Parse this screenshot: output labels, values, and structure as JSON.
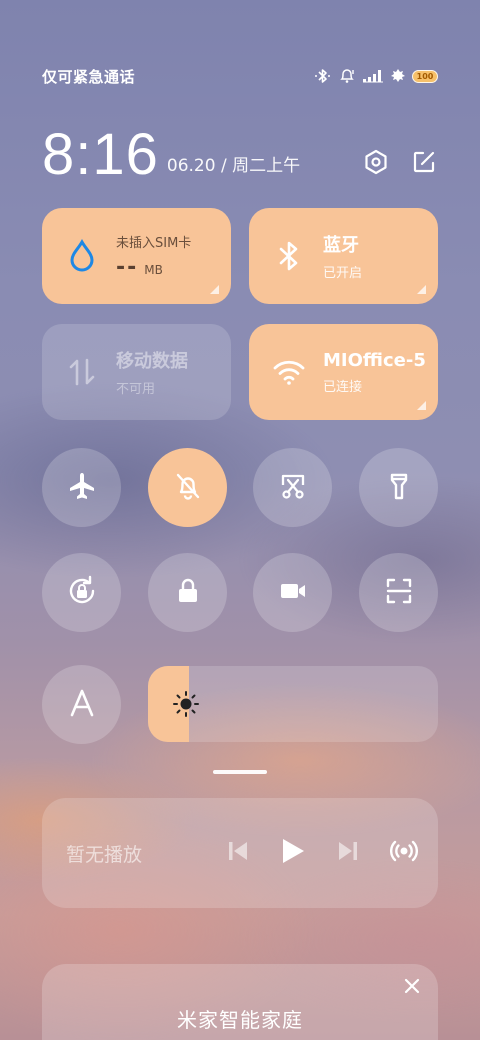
{
  "status": {
    "carrier": "仅可紧急通话",
    "battery": "100"
  },
  "header": {
    "time": "8:16",
    "date": "06.20 / 周二上午"
  },
  "tiles": {
    "data_usage": {
      "label": "未插入SIM卡",
      "value": "--",
      "unit": "MB"
    },
    "bluetooth": {
      "title": "蓝牙",
      "status": "已开启"
    },
    "mobile_data": {
      "title": "移动数据",
      "status": "不可用"
    },
    "wifi": {
      "title": "MIOffice-5",
      "status": "已连接"
    }
  },
  "toggles": [
    {
      "name": "airplane-mode",
      "icon": "airplane-icon",
      "on": false
    },
    {
      "name": "silent-mode",
      "icon": "bell-off-icon",
      "on": true
    },
    {
      "name": "screenshot",
      "icon": "scissors-icon",
      "on": false
    },
    {
      "name": "flashlight",
      "icon": "flashlight-icon",
      "on": false
    },
    {
      "name": "auto-rotate",
      "icon": "rotate-lock-icon",
      "on": false
    },
    {
      "name": "lock-screen",
      "icon": "lock-icon",
      "on": false
    },
    {
      "name": "screen-record",
      "icon": "video-icon",
      "on": false
    },
    {
      "name": "scanner",
      "icon": "scan-icon",
      "on": false
    },
    {
      "name": "auto-brightness",
      "icon": "letter-a-icon",
      "on": false
    }
  ],
  "brightness": {
    "level": 0.14
  },
  "media": {
    "status": "暂无播放"
  },
  "smart_home": {
    "title": "米家智能家庭"
  },
  "colors": {
    "accent": "#f8c498"
  }
}
